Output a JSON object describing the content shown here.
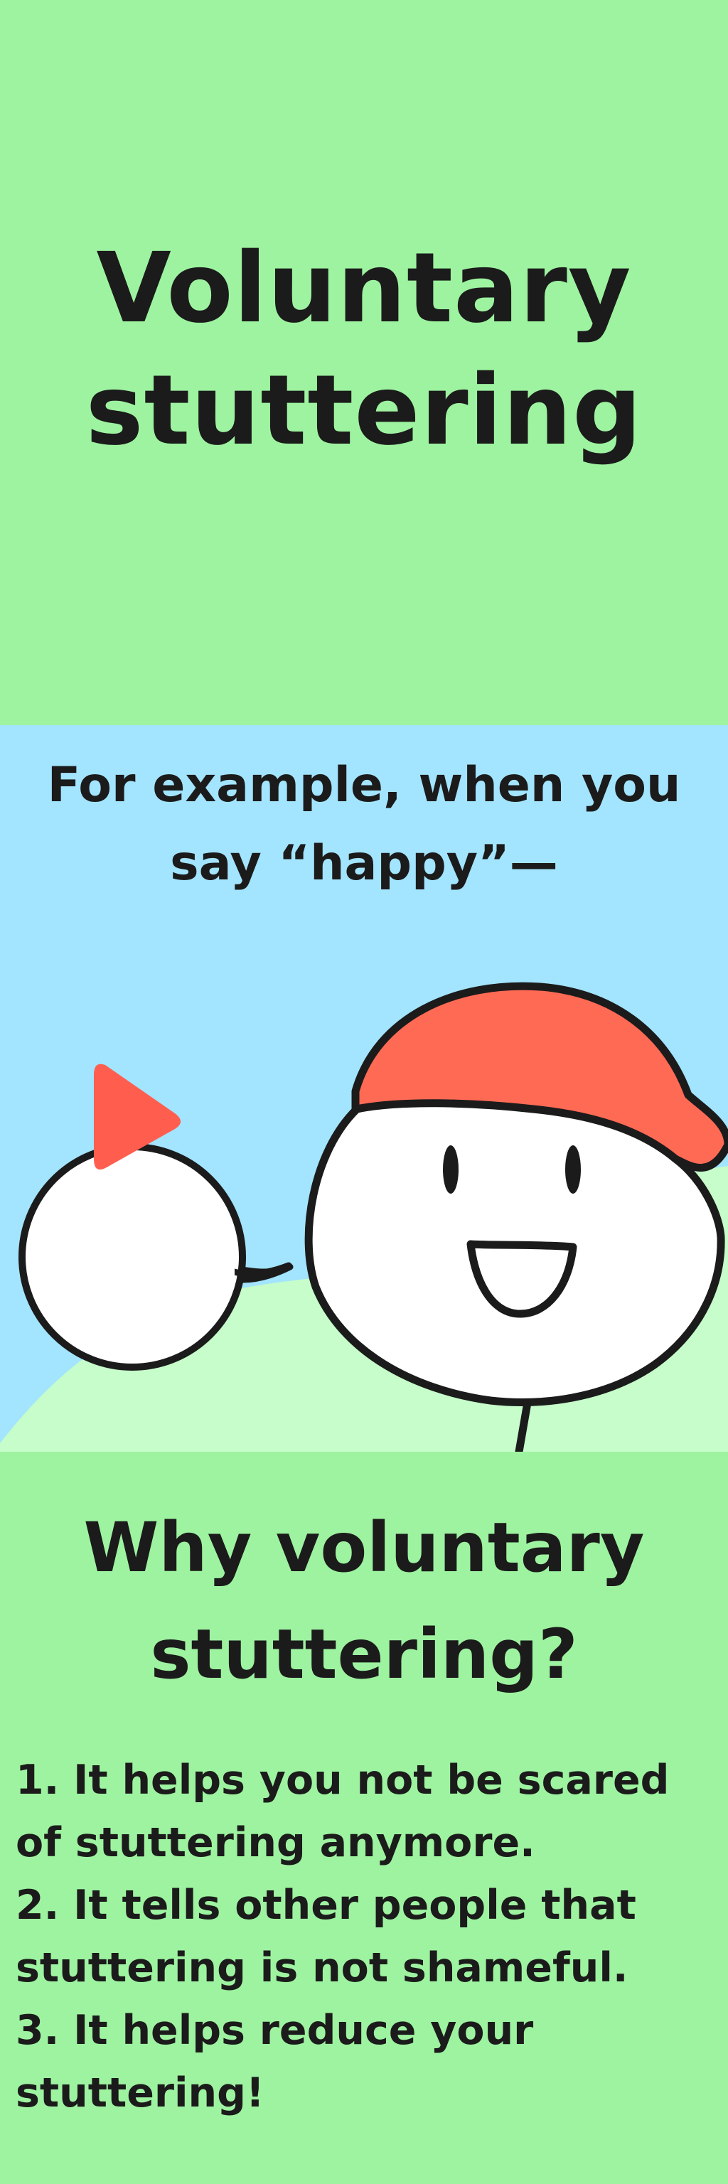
{
  "title": {
    "line1": "Voluntary",
    "line2": "stuttering"
  },
  "example": {
    "line1": "For example, when you",
    "line2": "say “happy”—"
  },
  "why": {
    "heading_line1": "Why voluntary",
    "heading_line2": "stuttering?",
    "reasons": [
      {
        "line1": "1. It helps you not be scared",
        "line2": "of stuttering anymore."
      },
      {
        "line1": "2. It tells other people that",
        "line2": "stuttering is not shameful."
      },
      {
        "line1": "3. It helps reduce your",
        "line2": "stuttering!"
      }
    ]
  },
  "icons": [
    "speech-bubble-icon",
    "play-icon"
  ],
  "colors": {
    "title_background": "#9ef3a0",
    "sky": "#a3e4fe",
    "hill": "#c6fdca",
    "cap": "#ff6a55",
    "play": "#ff5e4f",
    "ink": "#1b1b1b"
  }
}
